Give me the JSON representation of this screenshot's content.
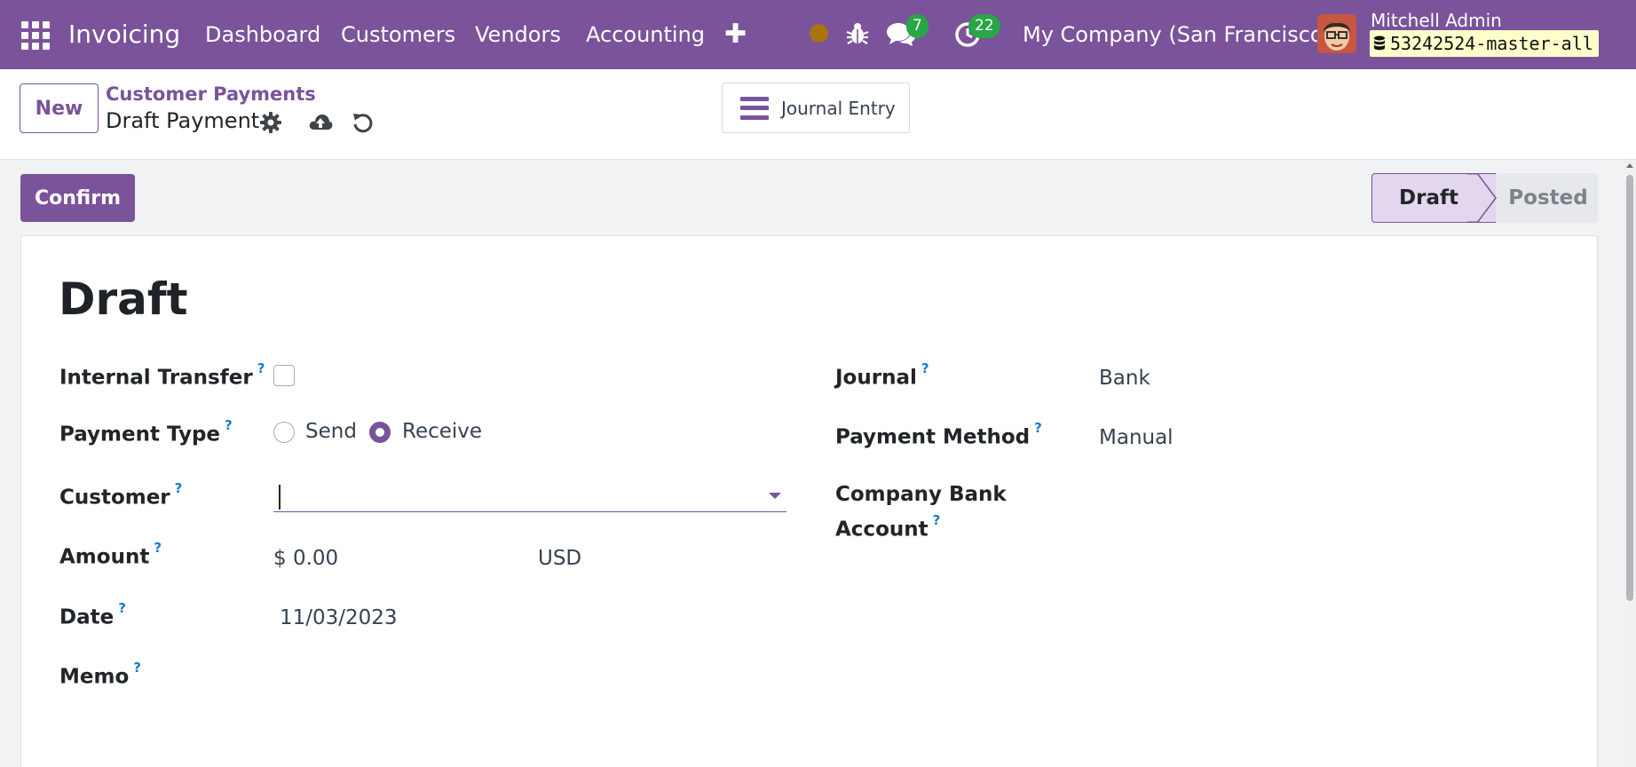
{
  "navbar": {
    "app_name": "Invoicing",
    "menu": [
      "Dashboard",
      "Customers",
      "Vendors",
      "Accounting"
    ],
    "icons": {
      "apps": "apps-grid-icon",
      "new": "plus-icon",
      "status": "status-dot-icon",
      "debug": "bug-icon",
      "chat": "chat-icon",
      "activity": "clock-icon"
    },
    "chat_count": "7",
    "activity_count": "22",
    "company": "My Company (San Francisco)",
    "user_name": "Mitchell Admin",
    "database": "53242524-master-all",
    "colors": {
      "brand": "#7a539b",
      "badge": "#27a745",
      "status_dot": "#a8740b"
    }
  },
  "control_panel": {
    "new_label": "New",
    "breadcrumb": "Customer Payments",
    "record_title": "Draft Payment",
    "journal_entry_label": "Journal Entry"
  },
  "statusbar": {
    "confirm_label": "Confirm",
    "stages": [
      "Draft",
      "Posted"
    ],
    "current_stage": "Draft"
  },
  "form": {
    "title": "Draft",
    "help_mark": "?",
    "internal_transfer": {
      "label": "Internal Transfer",
      "checked": false
    },
    "payment_type": {
      "label": "Payment Type",
      "options": [
        "Send",
        "Receive"
      ],
      "selected": "Receive"
    },
    "customer": {
      "label": "Customer",
      "value": ""
    },
    "amount": {
      "label": "Amount",
      "value": "$ 0.00",
      "currency": "USD"
    },
    "date": {
      "label": "Date",
      "value": "11/03/2023"
    },
    "memo": {
      "label": "Memo",
      "value": ""
    },
    "journal": {
      "label": "Journal",
      "value": "Bank"
    },
    "payment_method": {
      "label": "Payment Method",
      "value": "Manual"
    },
    "company_bank_account": {
      "label_line1": "Company Bank",
      "label_line2": "Account",
      "value": ""
    }
  }
}
